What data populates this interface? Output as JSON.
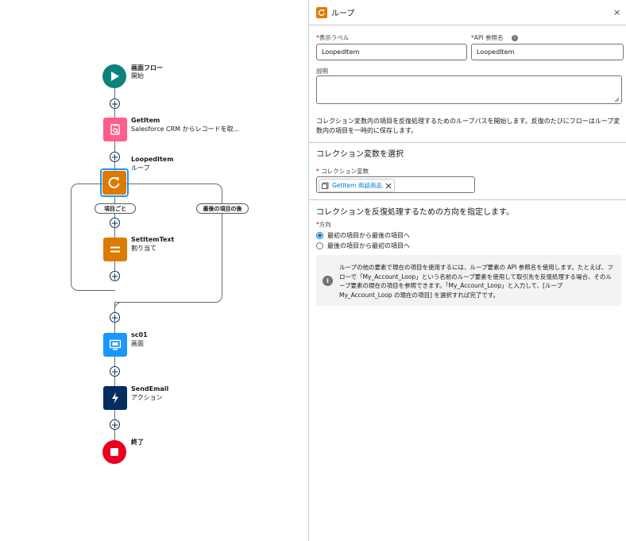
{
  "flow": {
    "start": {
      "title": "画面フロー",
      "subtitle": "開始"
    },
    "get_item": {
      "title": "GetItem",
      "subtitle": "Salesforce CRM からレコードを取..."
    },
    "loop": {
      "title": "LoopedItem",
      "subtitle": "ループ"
    },
    "for_each_label": "項目ごと",
    "after_last_label": "最後の項目の後",
    "assignment": {
      "title": "SetItemText",
      "subtitle": "割り当て"
    },
    "screen": {
      "title": "sc01",
      "subtitle": "画面"
    },
    "action": {
      "title": "SendEmail",
      "subtitle": "アクション"
    },
    "end": {
      "title": "終了"
    },
    "add_symbol": "+"
  },
  "panel": {
    "title": "ループ",
    "close_symbol": "×",
    "required_mark": "*",
    "label_field": {
      "label": "表示ラベル",
      "value": "LoopedItem"
    },
    "api_field": {
      "label": "API 参照名",
      "value": "LoopedItem"
    },
    "description_field": {
      "label": "説明",
      "value": ""
    },
    "intro_text": "コレクション変数内の項目を反復処理するためのループパスを開始します。反復のたびにフローはループ変数内の項目を一時的に保存します。",
    "collection_section_title": "コレクション変数を選択",
    "collection_field": {
      "label": "コレクション変数",
      "pill": "GetItem 商談商品"
    },
    "direction_section_title": "コレクションを反復処理するための方向を指定します。",
    "direction_label": "方向",
    "direction_options": [
      "最初の項目から最後の項目へ",
      "最後の項目から最初の項目へ"
    ],
    "direction_selected": 0,
    "info_text": "ループの他の要素で現在の項目を使用するには、ループ要素の API 参照名を使用します。たとえば、フローで「My_Account_Loop」という名前のループ要素を使用して取引先を反復処理する場合、そのループ要素の現在の項目を参照できます。「My_Account_Loop」と入力して、[ループ My_Account_Loop の現在の項目] を選択すれば完了です。",
    "colors": {
      "loop_orange": "#dd7a01",
      "brand_blue": "#0176d3",
      "start_teal": "#0b827c",
      "get_pink": "#ff5d8a",
      "screen_blue": "#1b96ff",
      "action_navy": "#032d60",
      "end_red": "#ea001e"
    }
  }
}
